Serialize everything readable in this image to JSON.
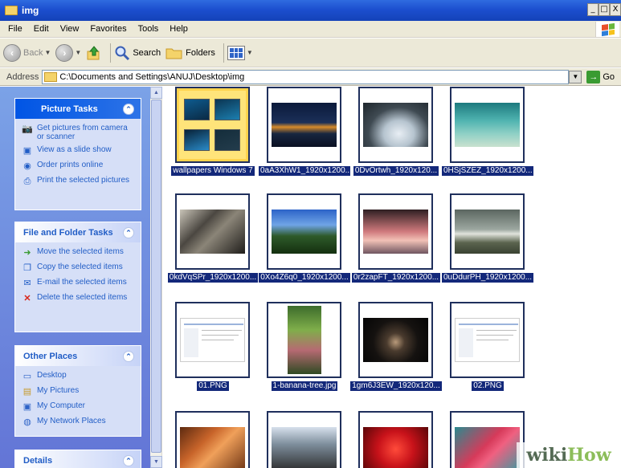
{
  "window": {
    "title": "img",
    "minimize": "_",
    "maximize": "□",
    "close": "X"
  },
  "menu": [
    "File",
    "Edit",
    "View",
    "Favorites",
    "Tools",
    "Help"
  ],
  "toolbar": {
    "back_label": "Back",
    "search_label": "Search",
    "folders_label": "Folders"
  },
  "address": {
    "label": "Address",
    "value": "C:\\Documents and Settings\\ANUJ\\Desktop\\img",
    "go_label": "Go"
  },
  "sidebar": {
    "picture_tasks": {
      "title": "Picture Tasks",
      "items": [
        {
          "icon": "camera-icon",
          "label": "Get pictures from camera or scanner"
        },
        {
          "icon": "slideshow-icon",
          "label": "View as a slide show"
        },
        {
          "icon": "globe-icon",
          "label": "Order prints online"
        },
        {
          "icon": "printer-icon",
          "label": "Print the selected pictures"
        }
      ]
    },
    "file_tasks": {
      "title": "File and Folder Tasks",
      "items": [
        {
          "icon": "move-icon",
          "label": "Move the selected items"
        },
        {
          "icon": "copy-icon",
          "label": "Copy the selected items"
        },
        {
          "icon": "email-icon",
          "label": "E-mail the selected items"
        },
        {
          "icon": "delete-icon",
          "label": "Delete the selected items"
        }
      ]
    },
    "other_places": {
      "title": "Other Places",
      "items": [
        {
          "icon": "desktop-icon",
          "label": "Desktop"
        },
        {
          "icon": "my-pictures-icon",
          "label": "My Pictures"
        },
        {
          "icon": "my-computer-icon",
          "label": "My Computer"
        },
        {
          "icon": "network-places-icon",
          "label": "My Network Places"
        }
      ]
    },
    "details": {
      "title": "Details"
    }
  },
  "files": [
    {
      "name": "wallpapers Windows 7",
      "kind": "folder"
    },
    {
      "name": "0aA3XhW1_1920x1200...",
      "kind": "image"
    },
    {
      "name": "0DvOrtwh_1920x120...",
      "kind": "image"
    },
    {
      "name": "0HSjSZEZ_1920x1200...",
      "kind": "image"
    },
    {
      "name": "0kdVqSPr_1920x1200...",
      "kind": "image"
    },
    {
      "name": "0Xo4Z6q0_1920x1200...",
      "kind": "image"
    },
    {
      "name": "0r2zapFT_1920x1200...",
      "kind": "image"
    },
    {
      "name": "0uDdurPH_1920x1200...",
      "kind": "image"
    },
    {
      "name": "01.PNG",
      "kind": "image"
    },
    {
      "name": "1-banana-tree.jpg",
      "kind": "image"
    },
    {
      "name": "1gm6J3EW_1920x120...",
      "kind": "image"
    },
    {
      "name": "02.PNG",
      "kind": "image"
    }
  ],
  "watermark": {
    "part1": "wiki",
    "part2": "How"
  }
}
